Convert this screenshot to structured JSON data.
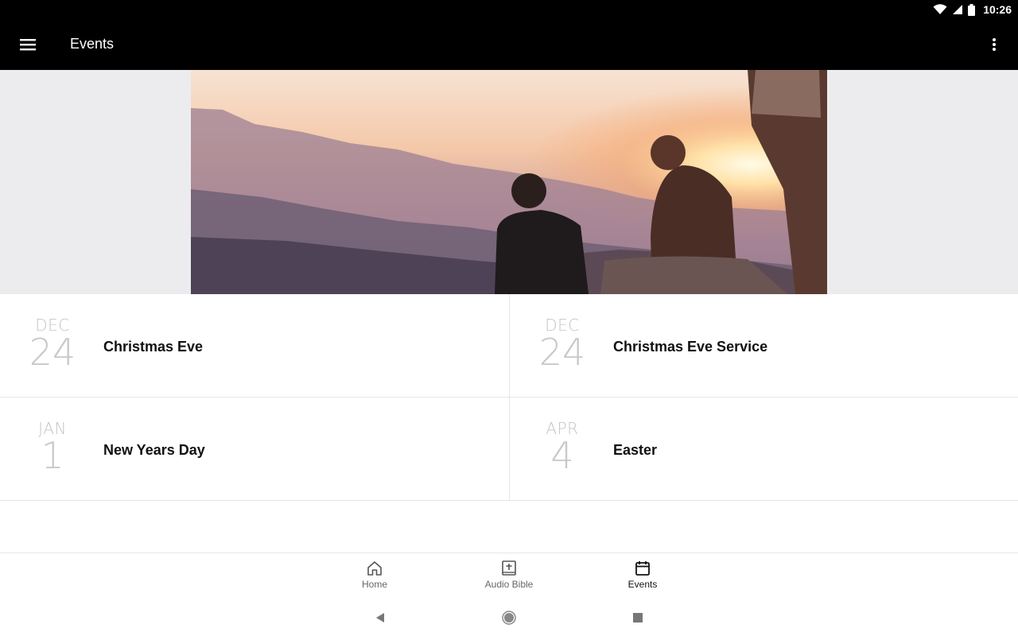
{
  "status_bar": {
    "time": "10:26"
  },
  "app_bar": {
    "title": "Events"
  },
  "events": [
    {
      "month": "DEC",
      "day": "24",
      "title": "Christmas Eve"
    },
    {
      "month": "DEC",
      "day": "24",
      "title": "Christmas Eve Service"
    },
    {
      "month": "JAN",
      "day": "1",
      "title": "New Years Day"
    },
    {
      "month": "APR",
      "day": "4",
      "title": "Easter"
    }
  ],
  "bottom_nav": {
    "items": [
      {
        "label": "Home",
        "icon": "home-icon"
      },
      {
        "label": "Audio Bible",
        "icon": "bible-icon"
      },
      {
        "label": "Events",
        "icon": "calendar-icon",
        "active": true
      }
    ]
  },
  "colors": {
    "app_bar_bg": "#000000",
    "date_gray": "#c4c4c4",
    "divider": "#e6e6e6"
  }
}
